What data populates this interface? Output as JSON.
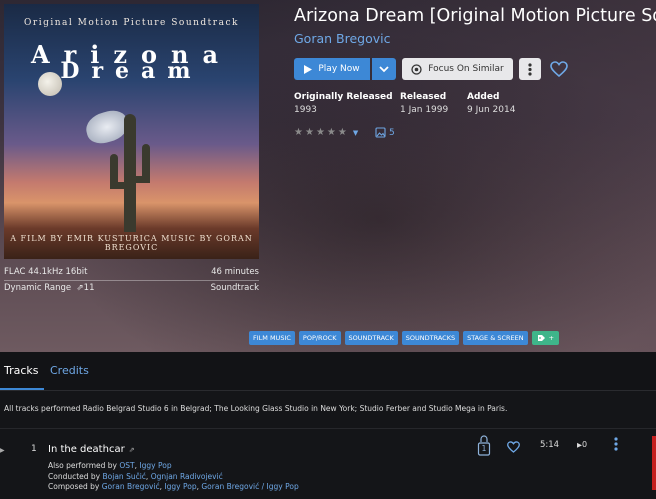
{
  "album": {
    "title": "Arizona Dream [Original Motion Picture Soundtrack]",
    "artist": "Goran Bregovic",
    "cover": {
      "top_text": "Original Motion Picture Soundtrack",
      "title_line1": "Arizona",
      "title_line2": "Dream",
      "bottom_text": "A FILM BY EMIR KUSTURICA   MUSIC BY GORAN BREGOVIC"
    },
    "format": "FLAC 44.1kHz 16bit",
    "duration": "46 minutes",
    "dynamic_range_label": "Dynamic Range",
    "dynamic_range_value": "11",
    "genre": "Soundtrack"
  },
  "actions": {
    "play_label": "Play Now",
    "focus_label": "Focus On Similar"
  },
  "dates": {
    "original_label": "Originally Released",
    "original_value": "1993",
    "released_label": "Released",
    "released_value": "1 Jan 1999",
    "added_label": "Added",
    "added_value": "9 Jun 2014"
  },
  "rating": {
    "stars": 0,
    "max": 5
  },
  "photos_count": "5",
  "tags": [
    "FILM MUSIC",
    "POP/ROCK",
    "SOUNDTRACK",
    "SOUNDTRACKS",
    "STAGE & SCREEN"
  ],
  "tag_add_label": "+",
  "tabs": {
    "tracks": "Tracks",
    "credits": "Credits"
  },
  "notes": "All tracks performed Radio Belgrad Studio 6 in Belgrad; The Looking Glass Studio in New York; Studio Ferber and Studio Mega in Paris.",
  "track": {
    "number": "1",
    "title": "In the deathcar",
    "performed_label": "Also performed by",
    "performed_by": [
      "OST",
      "Iggy Pop"
    ],
    "conducted_label": "Conducted by",
    "conducted_by": [
      "Bojan Sučić",
      "Ognjan Radivojević"
    ],
    "composed_label": "Composed by",
    "composed_by": [
      "Goran Bregović",
      "Iggy Pop",
      "Goran Bregović / Iggy Pop"
    ],
    "badge_count": "1",
    "duration": "5:14",
    "plays": "0"
  },
  "colors": {
    "accent": "#3d88d6",
    "link": "#6fa8e6",
    "tag_add": "#3fb58a"
  }
}
